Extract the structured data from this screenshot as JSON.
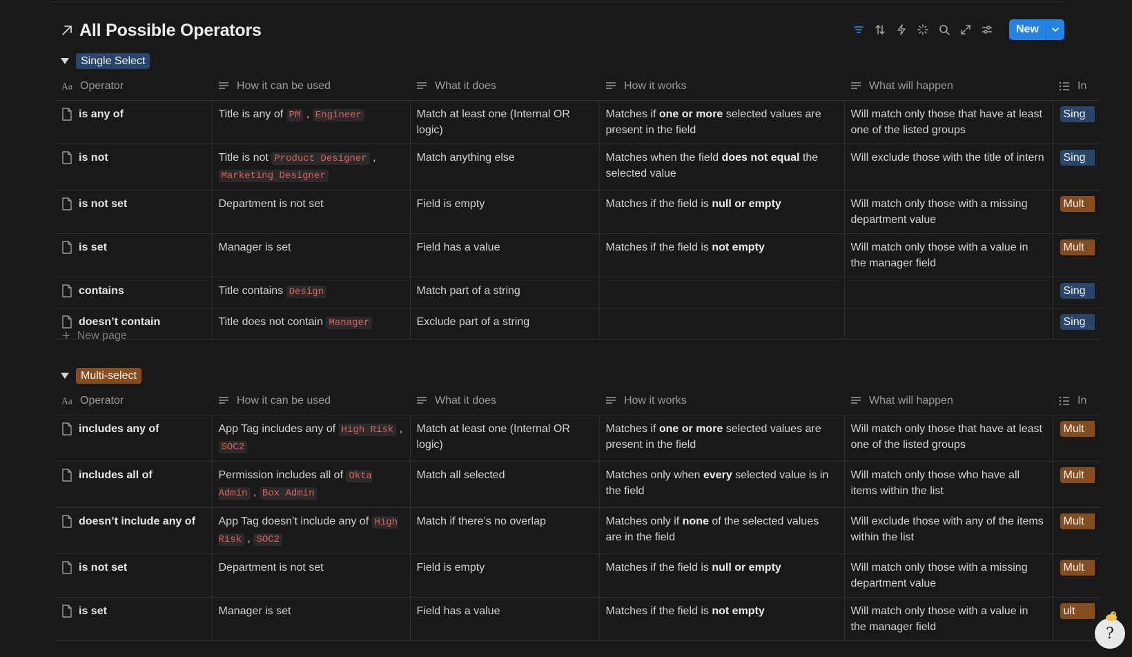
{
  "page": {
    "title": "All Possible Operators"
  },
  "toolbar": {
    "new_label": "New",
    "icons": [
      "filter-icon",
      "sort-icon",
      "automation-icon",
      "ai-sparkle-icon",
      "search-icon",
      "expand-icon",
      "settings-icon",
      "chevron-down-icon"
    ]
  },
  "colors": {
    "accent": "#2383e2",
    "code_text": "#e0605b",
    "tag_blue": "#28456c",
    "tag_orange": "#854c1d"
  },
  "columns": {
    "operator": "Operator",
    "how_used": "How it can be used",
    "what_does": "What it does",
    "how_works": "How it works",
    "what_happen": "What will happen",
    "last": "In"
  },
  "groups": [
    {
      "label": "Single Select",
      "color": "blue",
      "new_page_label": "New page",
      "rows": [
        {
          "operator": "is any of",
          "usage_parts": [
            {
              "t": "text",
              "v": "Title is any of "
            },
            {
              "t": "code",
              "v": "PM"
            },
            {
              "t": "text",
              "v": " , "
            },
            {
              "t": "code",
              "v": "Engineer"
            }
          ],
          "what_does": "Match at least one (Internal OR logic)",
          "how_parts": [
            {
              "t": "text",
              "v": "Matches if "
            },
            {
              "t": "bold",
              "v": "one or more"
            },
            {
              "t": "text",
              "v": " selected values are present in the field"
            }
          ],
          "what_happen": "Will match only those that have at least one of the listed groups",
          "last_tag": "Sing",
          "last_color": "blue"
        },
        {
          "operator": "is not",
          "usage_parts": [
            {
              "t": "text",
              "v": "Title is not "
            },
            {
              "t": "code",
              "v": "Product Designer"
            },
            {
              "t": "text",
              "v": " , "
            },
            {
              "t": "code",
              "v": "Marketing Designer"
            }
          ],
          "what_does": "Match anything else",
          "how_parts": [
            {
              "t": "text",
              "v": "Matches when the field "
            },
            {
              "t": "bold",
              "v": "does not equal"
            },
            {
              "t": "text",
              "v": " the selected value"
            }
          ],
          "what_happen": "Will exclude those with the title of intern",
          "last_tag": "Sing",
          "last_color": "blue"
        },
        {
          "operator": "is not set",
          "usage_parts": [
            {
              "t": "text",
              "v": "Department is not set"
            }
          ],
          "what_does": "Field is empty",
          "how_parts": [
            {
              "t": "text",
              "v": "Matches if the field is "
            },
            {
              "t": "bold",
              "v": "null or empty"
            }
          ],
          "what_happen": "Will match only those with a missing department value",
          "last_tag": "Mult",
          "last_color": "orange"
        },
        {
          "operator": "is set",
          "usage_parts": [
            {
              "t": "text",
              "v": "Manager is set"
            }
          ],
          "what_does": "Field has a value",
          "how_parts": [
            {
              "t": "text",
              "v": "Matches if the field is "
            },
            {
              "t": "bold",
              "v": "not empty"
            }
          ],
          "what_happen": "Will match only those with a value in the manager field",
          "last_tag": "Mult",
          "last_color": "orange"
        },
        {
          "operator": "contains",
          "usage_parts": [
            {
              "t": "text",
              "v": "Title contains "
            },
            {
              "t": "code",
              "v": "Design"
            }
          ],
          "what_does": "Match part of a string",
          "how_parts": [],
          "what_happen": "",
          "last_tag": "Sing",
          "last_color": "blue"
        },
        {
          "operator": "doesn’t contain",
          "usage_parts": [
            {
              "t": "text",
              "v": "Title does not contain "
            },
            {
              "t": "code",
              "v": "Manager"
            }
          ],
          "what_does": "Exclude part of a string",
          "how_parts": [],
          "what_happen": "",
          "last_tag": "Sing",
          "last_color": "blue"
        }
      ]
    },
    {
      "label": "Multi-select",
      "color": "orange",
      "rows": [
        {
          "operator": "includes any of",
          "usage_parts": [
            {
              "t": "text",
              "v": "App Tag includes any of "
            },
            {
              "t": "code",
              "v": "High Risk"
            },
            {
              "t": "text",
              "v": " , "
            },
            {
              "t": "code",
              "v": "SOC2"
            }
          ],
          "what_does": "Match at least one (Internal OR logic)",
          "how_parts": [
            {
              "t": "text",
              "v": "Matches if "
            },
            {
              "t": "bold",
              "v": "one or more"
            },
            {
              "t": "text",
              "v": " selected values are present in the field"
            }
          ],
          "what_happen": "Will match only those that have at least one of the listed groups",
          "last_tag": "Mult",
          "last_color": "orange"
        },
        {
          "operator": "includes all of",
          "usage_parts": [
            {
              "t": "text",
              "v": "Permission includes all of "
            },
            {
              "t": "code",
              "v": "Okta Admin"
            },
            {
              "t": "text",
              "v": " , "
            },
            {
              "t": "code",
              "v": "Box Admin"
            }
          ],
          "what_does": "Match all selected",
          "how_parts": [
            {
              "t": "text",
              "v": "Matches only when "
            },
            {
              "t": "bold",
              "v": "every"
            },
            {
              "t": "text",
              "v": " selected value is in the field"
            }
          ],
          "what_happen": "Will match only those who have all items within the list",
          "last_tag": "Mult",
          "last_color": "orange"
        },
        {
          "operator": "doesn’t include any of",
          "usage_parts": [
            {
              "t": "text",
              "v": "App Tag doesn’t include any of "
            },
            {
              "t": "code",
              "v": "High Risk"
            },
            {
              "t": "text",
              "v": " , "
            },
            {
              "t": "code",
              "v": "SOC2"
            }
          ],
          "what_does": "Match if there’s no overlap",
          "how_parts": [
            {
              "t": "text",
              "v": "Matches only if "
            },
            {
              "t": "bold",
              "v": "none"
            },
            {
              "t": "text",
              "v": " of the selected values are in the field"
            }
          ],
          "what_happen": "Will exclude those with any of the items within the list",
          "last_tag": "Mult",
          "last_color": "orange"
        },
        {
          "operator": "is not set",
          "usage_parts": [
            {
              "t": "text",
              "v": "Department is not set"
            }
          ],
          "what_does": "Field is empty",
          "how_parts": [
            {
              "t": "text",
              "v": "Matches if the field is "
            },
            {
              "t": "bold",
              "v": "null or empty"
            }
          ],
          "what_happen": "Will match only those with a missing department value",
          "last_tag": "Mult",
          "last_color": "orange"
        },
        {
          "operator": "is set",
          "usage_parts": [
            {
              "t": "text",
              "v": "Manager is set"
            }
          ],
          "what_does": "Field has a value",
          "how_parts": [
            {
              "t": "text",
              "v": "Matches if the field is "
            },
            {
              "t": "bold",
              "v": "not empty"
            }
          ],
          "what_happen": "Will match only those with a value in the manager field",
          "last_tag": "ult",
          "last_color": "orange"
        }
      ]
    }
  ]
}
